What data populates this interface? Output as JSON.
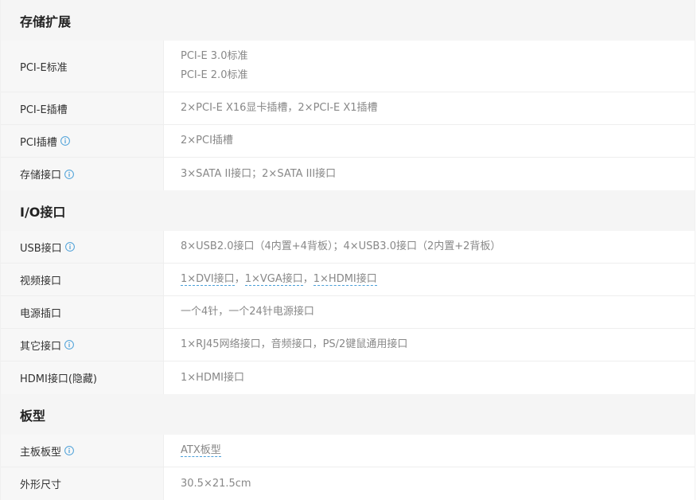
{
  "sections": [
    {
      "title": "存储扩展",
      "rows": [
        {
          "name": "PCI-E标准",
          "info": false,
          "values": [
            "PCI-E 3.0标准",
            "PCI-E 2.0标准"
          ]
        },
        {
          "name": "PCI-E插槽",
          "info": false,
          "values": [
            "2×PCI-E X16显卡插槽，2×PCI-E X1插槽"
          ]
        },
        {
          "name": "PCI插槽",
          "info": true,
          "values": [
            "2×PCI插槽"
          ]
        },
        {
          "name": "存储接口",
          "info": true,
          "values": [
            "3×SATA II接口；2×SATA III接口"
          ]
        }
      ]
    },
    {
      "title": "I/O接口",
      "rows": [
        {
          "name": "USB接口",
          "info": true,
          "values": [
            "8×USB2.0接口（4内置+4背板）；4×USB3.0接口（2内置+2背板）"
          ]
        },
        {
          "name": "视频接口",
          "info": false,
          "links": [
            "1×DVI接口",
            "1×VGA接口",
            "1×HDMI接口"
          ],
          "link_separator": "，"
        },
        {
          "name": "电源插口",
          "info": false,
          "values": [
            "一个4针，一个24针电源接口"
          ]
        },
        {
          "name": "其它接口",
          "info": true,
          "values": [
            "1×RJ45网络接口，音频接口，PS/2键鼠通用接口"
          ]
        },
        {
          "name": "HDMI接口(隐藏)",
          "info": false,
          "values": [
            "1×HDMI接口"
          ]
        }
      ]
    },
    {
      "title": "板型",
      "rows": [
        {
          "name": "主板板型",
          "info": true,
          "links": [
            "ATX板型"
          ]
        },
        {
          "name": "外形尺寸",
          "info": false,
          "values": [
            "30.5×21.5cm"
          ]
        }
      ]
    }
  ],
  "icons": {
    "info": "info-circle-icon"
  },
  "colors": {
    "header_bg": "#f5f5f5",
    "name_bg": "#f7f7f7",
    "value_text": "#888888",
    "info_icon": "#4a9fd8"
  }
}
